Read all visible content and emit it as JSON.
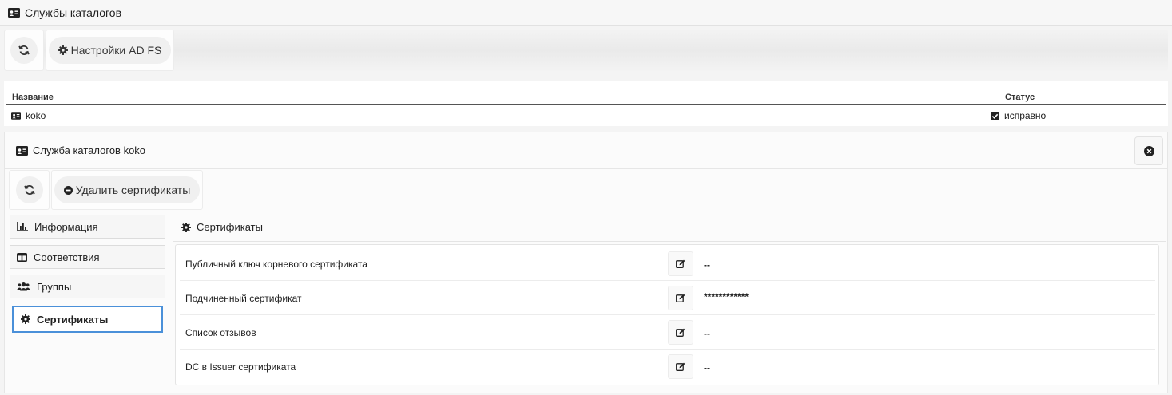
{
  "app": {
    "title": "Службы каталогов"
  },
  "toolbar": {
    "adfs_label": "Настройки AD FS"
  },
  "list": {
    "columns": [
      "Название",
      "Статус"
    ],
    "rows": [
      {
        "name": "koko",
        "status": "исправно"
      }
    ]
  },
  "detail": {
    "title": "Служба каталогов koko",
    "delete_label": "Удалить сертификаты",
    "nav": [
      {
        "label": "Информация",
        "icon": "chart-icon"
      },
      {
        "label": "Соответствия",
        "icon": "columns-icon"
      },
      {
        "label": "Группы",
        "icon": "users-icon"
      },
      {
        "label": "Сертификаты",
        "icon": "gear-icon"
      }
    ],
    "section_title": "Сертификаты",
    "certs": [
      {
        "label": "Публичный ключ корневого сертификата",
        "value": "--"
      },
      {
        "label": "Подчиненный сертификат",
        "value": "************"
      },
      {
        "label": "Список отзывов",
        "value": "--"
      },
      {
        "label": "DC в Issuer сертификата",
        "value": "--"
      }
    ]
  }
}
